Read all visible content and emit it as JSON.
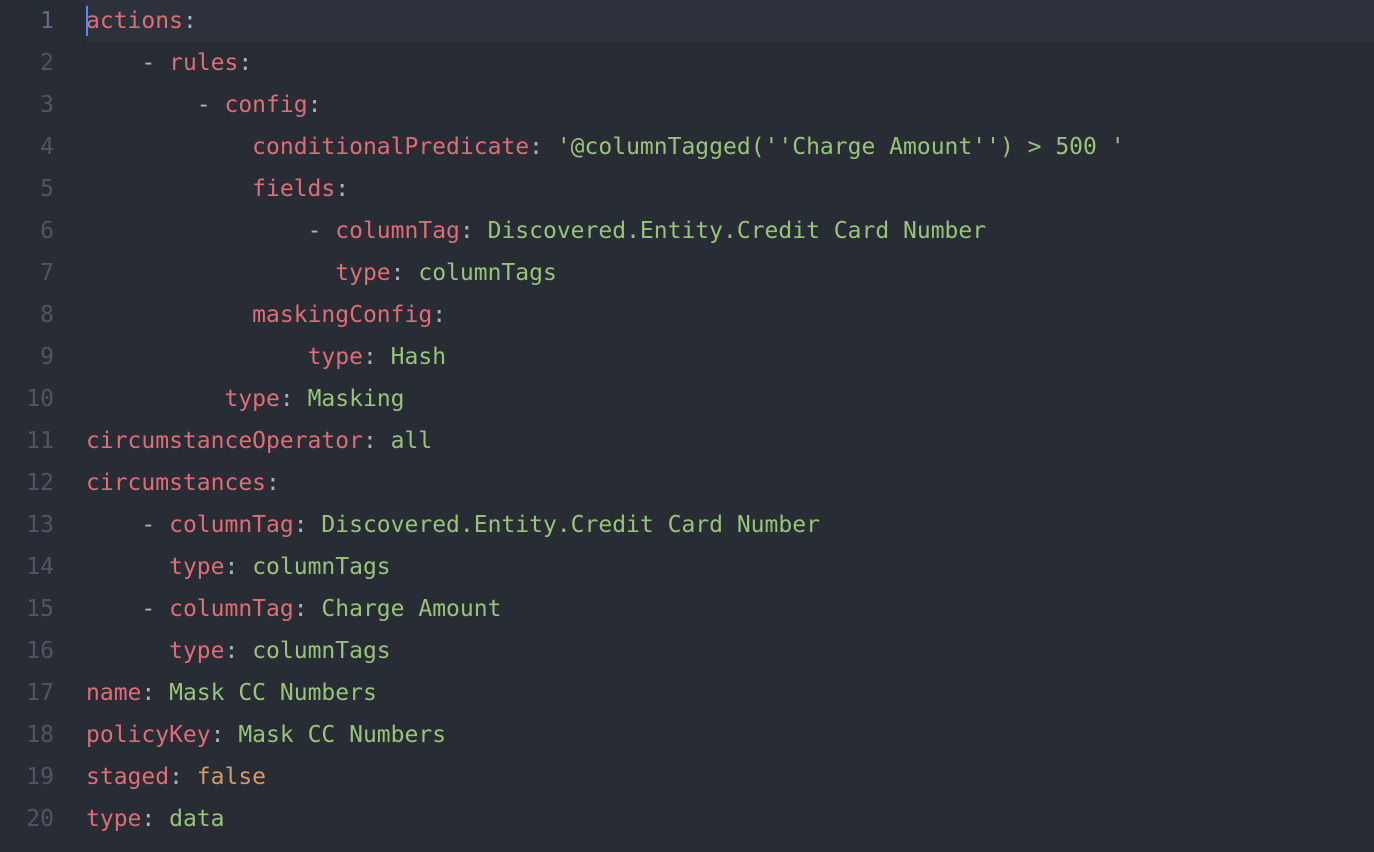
{
  "lines": {
    "n1": "1",
    "n2": "2",
    "n3": "3",
    "n4": "4",
    "n5": "5",
    "n6": "6",
    "n7": "7",
    "n8": "8",
    "n9": "9",
    "n10": "10",
    "n11": "11",
    "n12": "12",
    "n13": "13",
    "n14": "14",
    "n15": "15",
    "n16": "16",
    "n17": "17",
    "n18": "18",
    "n19": "19",
    "n20": "20"
  },
  "code": {
    "l1": {
      "key": "actions",
      "colon": ":"
    },
    "l2": {
      "indent": "    ",
      "dash": "- ",
      "key": "rules",
      "colon": ":"
    },
    "l3": {
      "indent": "        ",
      "dash": "- ",
      "key": "config",
      "colon": ":"
    },
    "l4": {
      "indent": "            ",
      "key": "conditionalPredicate",
      "colon": ": ",
      "value": "'@columnTagged(''Charge Amount'') > 500 '"
    },
    "l5": {
      "indent": "            ",
      "key": "fields",
      "colon": ":"
    },
    "l6": {
      "indent": "                ",
      "dash": "- ",
      "key": "columnTag",
      "colon": ": ",
      "value": "Discovered.Entity.Credit Card Number"
    },
    "l7": {
      "indent": "                  ",
      "key": "type",
      "colon": ": ",
      "value": "columnTags"
    },
    "l8": {
      "indent": "            ",
      "key": "maskingConfig",
      "colon": ":"
    },
    "l9": {
      "indent": "                ",
      "key": "type",
      "colon": ": ",
      "value": "Hash"
    },
    "l10": {
      "indent": "          ",
      "key": "type",
      "colon": ": ",
      "value": "Masking"
    },
    "l11": {
      "key": "circumstanceOperator",
      "colon": ": ",
      "value": "all"
    },
    "l12": {
      "key": "circumstances",
      "colon": ":"
    },
    "l13": {
      "indent": "    ",
      "dash": "- ",
      "key": "columnTag",
      "colon": ": ",
      "value": "Discovered.Entity.Credit Card Number"
    },
    "l14": {
      "indent": "      ",
      "key": "type",
      "colon": ": ",
      "value": "columnTags"
    },
    "l15": {
      "indent": "    ",
      "dash": "- ",
      "key": "columnTag",
      "colon": ": ",
      "value": "Charge Amount"
    },
    "l16": {
      "indent": "      ",
      "key": "type",
      "colon": ": ",
      "value": "columnTags"
    },
    "l17": {
      "key": "name",
      "colon": ": ",
      "value": "Mask CC Numbers"
    },
    "l18": {
      "key": "policyKey",
      "colon": ": ",
      "value": "Mask CC Numbers"
    },
    "l19": {
      "key": "staged",
      "colon": ": ",
      "value": "false"
    },
    "l20": {
      "key": "type",
      "colon": ": ",
      "value": "data"
    }
  }
}
